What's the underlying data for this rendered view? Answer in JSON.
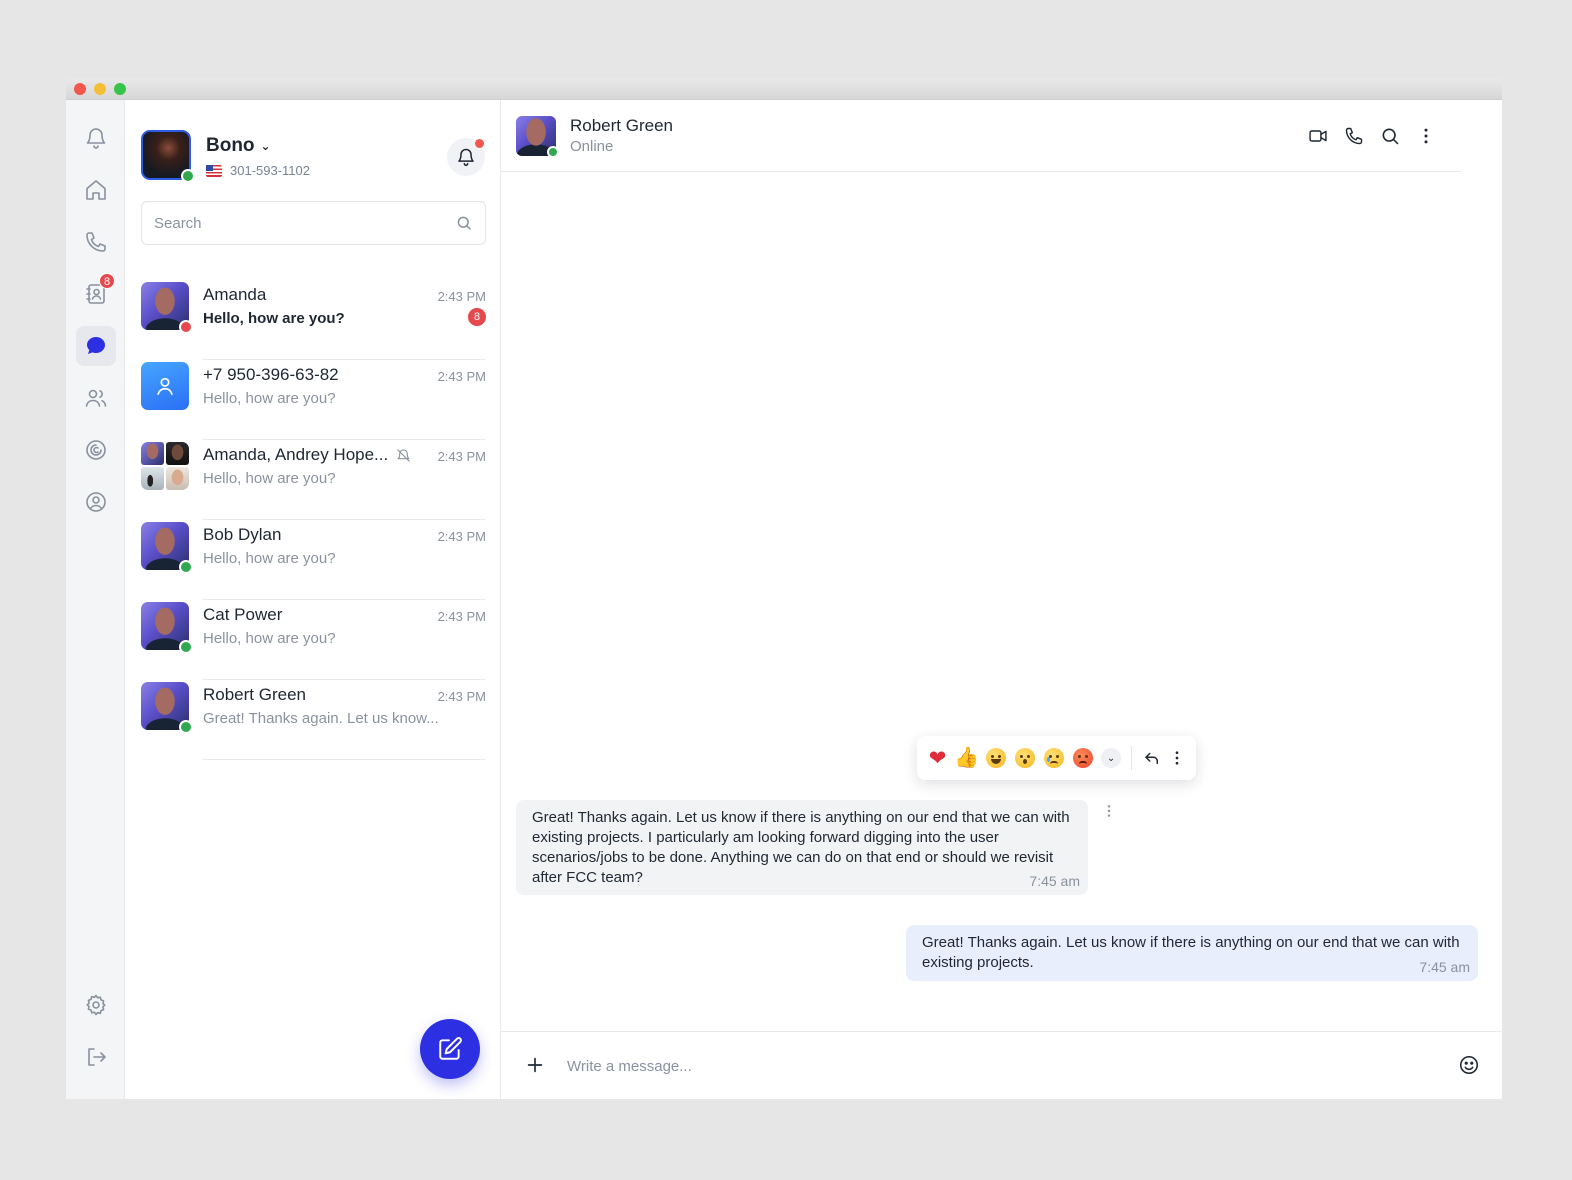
{
  "window": {
    "traffic_lights": [
      "close",
      "minimize",
      "maximize"
    ]
  },
  "colors": {
    "accent": "#2d2fe3",
    "online": "#2fa84f",
    "badge": "#e5484d"
  },
  "rail": {
    "items": [
      {
        "name": "bell-icon",
        "active": false
      },
      {
        "name": "home-icon",
        "active": false
      },
      {
        "name": "phone-icon",
        "active": false
      },
      {
        "name": "contacts-book-icon",
        "active": false,
        "badge": "8"
      },
      {
        "name": "chat-bubble-icon",
        "active": true
      },
      {
        "name": "users-icon",
        "active": false
      },
      {
        "name": "integrations-icon",
        "active": false
      },
      {
        "name": "profile-icon",
        "active": false
      }
    ],
    "bottom": [
      {
        "name": "gear-icon"
      },
      {
        "name": "logout-icon"
      }
    ]
  },
  "me": {
    "name": "Bono",
    "phone": "301-593-1102",
    "status": "online"
  },
  "search": {
    "placeholder": "Search"
  },
  "chats": [
    {
      "name": "Amanda",
      "time": "2:43 PM",
      "preview": "Hello, how are you?",
      "unread": "8",
      "status": "busy"
    },
    {
      "name": "+7 950-396-63-82",
      "time": "2:43 PM",
      "preview": "Hello, how are you?"
    },
    {
      "name": "Amanda, Andrey Hope...",
      "time": "2:43 PM",
      "preview": "Hello, how are you?",
      "muted": true
    },
    {
      "name": "Bob Dylan",
      "time": "2:43 PM",
      "preview": "Hello, how are you?",
      "status": "online"
    },
    {
      "name": "Cat Power",
      "time": "2:43 PM",
      "preview": "Hello, how are you?",
      "status": "online"
    },
    {
      "name": "Robert Green",
      "time": "2:43 PM",
      "preview": "Great! Thanks again. Let us know...",
      "status": "online"
    }
  ],
  "conversation": {
    "name": "Robert Green",
    "status": "Online",
    "actions": [
      "video-camera-icon",
      "phone-icon",
      "search-icon",
      "more-vertical-icon"
    ]
  },
  "reactions": [
    "heart",
    "thumbs-up",
    "laughing",
    "surprised",
    "crying",
    "angry"
  ],
  "messages": [
    {
      "direction": "in",
      "text": "Great! Thanks again. Let us know if there is anything on our end that we can with existing projects. I particularly am looking forward digging into the user scenarios/jobs to be done. Anything we can do on that end or should we revisit after FCC team?",
      "time": "7:45 am"
    },
    {
      "direction": "out",
      "text": "Great! Thanks again. Let us know if there is anything on our end that we can with existing projects.",
      "time": "7:45 am"
    }
  ],
  "composer": {
    "placeholder": "Write a message..."
  }
}
